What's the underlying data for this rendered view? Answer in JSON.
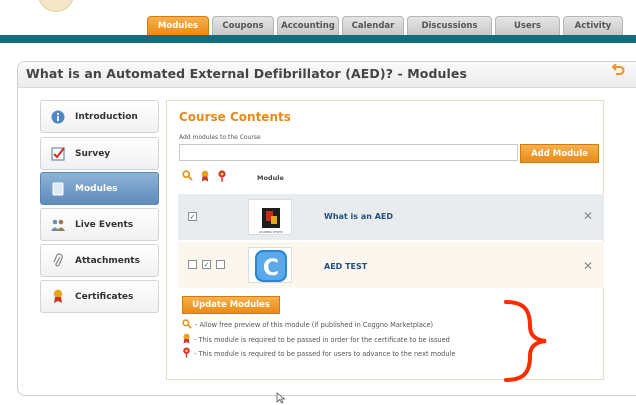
{
  "nav": {
    "tabs": [
      {
        "label": "Modules",
        "active": true
      },
      {
        "label": "Coupons",
        "active": false
      },
      {
        "label": "Accounting",
        "active": false
      },
      {
        "label": "Calendar",
        "active": false
      },
      {
        "label": "Discussions",
        "active": false
      },
      {
        "label": "Users",
        "active": false
      },
      {
        "label": "Activity",
        "active": false
      }
    ]
  },
  "page": {
    "title": "What is an Automated External Defibrillator (AED)? - Modules",
    "back_icon": "back-arrow-icon"
  },
  "sidebar": {
    "items": [
      {
        "label": "Introduction",
        "icon": "info-icon",
        "active": false
      },
      {
        "label": "Survey",
        "icon": "checkbox-icon",
        "active": false
      },
      {
        "label": "Modules",
        "icon": "document-icon",
        "active": true
      },
      {
        "label": "Live Events",
        "icon": "people-icon",
        "active": false
      },
      {
        "label": "Attachments",
        "icon": "paperclip-icon",
        "active": false
      },
      {
        "label": "Certificates",
        "icon": "ribbon-icon",
        "active": false
      }
    ]
  },
  "content": {
    "title": "Course Contents",
    "add_label": "Add modules to the Course",
    "input_value": "",
    "add_button": "Add Module",
    "column_header": "Module",
    "modules": [
      {
        "name": "What is an AED",
        "thumb_text": "LEARNING CENTER",
        "preview": true,
        "required_cert": false,
        "required_next": false
      },
      {
        "name": "AED TEST",
        "thumb_text": "C",
        "preview": false,
        "required_cert": true,
        "required_next": false
      }
    ],
    "update_button": "Update Modules",
    "legend": [
      "- Allow free preview of this module (if published in Coggno Marketplace)",
      "- This module is required to be passed in order for the certificate to be issued",
      "- This module is required to be passed for users to advance to the next module"
    ]
  },
  "colors": {
    "accent": "#ea8a16",
    "nav_bar": "#136d7d",
    "active_sidebar": "#6f99c4",
    "annotation_brace": "#ff2a00"
  }
}
